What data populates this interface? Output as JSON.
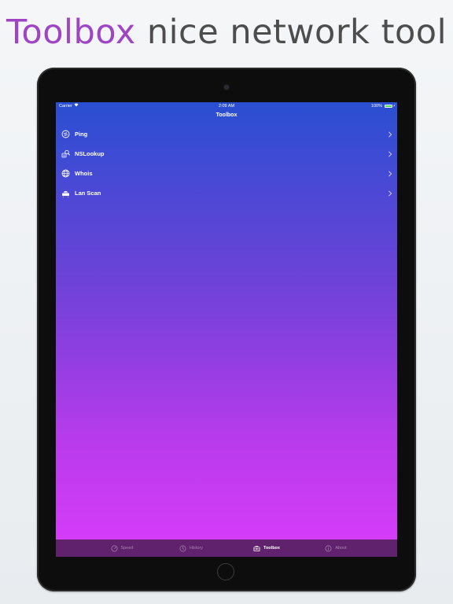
{
  "headline": {
    "accent": "Toolbox",
    "rest": " nice network tool"
  },
  "status_bar": {
    "carrier": "Carrier",
    "time": "2:09 AM",
    "battery": "100%"
  },
  "nav": {
    "title": "Toolbox"
  },
  "menu": {
    "items": [
      {
        "label": "Ping",
        "icon": "ping-icon"
      },
      {
        "label": "NSLookup",
        "icon": "nslookup-icon"
      },
      {
        "label": "Whois",
        "icon": "globe-icon"
      },
      {
        "label": "Lan Scan",
        "icon": "router-icon"
      }
    ]
  },
  "tabbar": {
    "tabs": [
      {
        "label": "Speed",
        "icon": "speedometer-icon",
        "active": false
      },
      {
        "label": "History",
        "icon": "clock-icon",
        "active": false
      },
      {
        "label": "Toolbox",
        "icon": "toolbox-icon",
        "active": true
      },
      {
        "label": "About",
        "icon": "info-icon",
        "active": false
      }
    ]
  },
  "colors": {
    "accent_headline": "#9f45c4",
    "gradient_top": "#2a4fd2",
    "gradient_bottom": "#d93cfb",
    "tabbar_bg": "#61226d"
  }
}
